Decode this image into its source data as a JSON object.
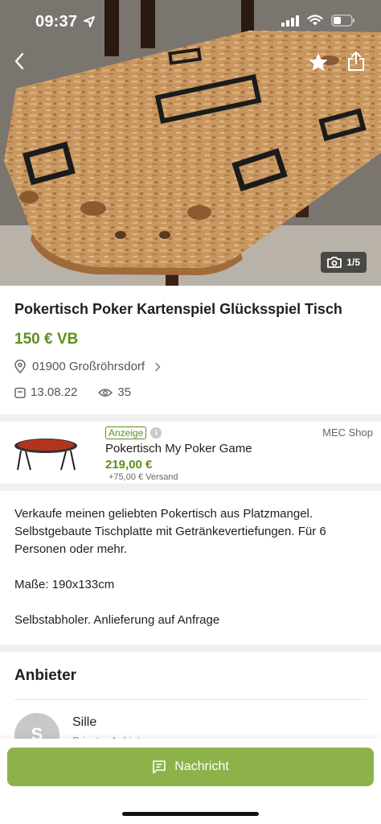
{
  "status_bar": {
    "time": "09:37",
    "icons": [
      "location-arrow-icon",
      "cellular-signal-icon",
      "wifi-icon",
      "battery-icon"
    ]
  },
  "hero": {
    "photo_counter": "1/5",
    "actions": [
      "back-icon",
      "star-icon",
      "share-icon"
    ]
  },
  "listing": {
    "title": "Pokertisch Poker Kartenspiel Glücksspiel Tisch",
    "price": "150 € VB",
    "location": "01900 Großröhrsdorf",
    "date": "13.08.22",
    "views": "35"
  },
  "ad": {
    "badge": "Anzeige",
    "shop": "MEC Shop",
    "title": "Pokertisch My Poker Game",
    "price": "219,00 €",
    "shipping": "+75,00 € Versand"
  },
  "description": {
    "line1": "Verkaufe meinen geliebten Pokertisch aus Platzmangel. Selbstgebaute Tischplatte mit Getränkevertiefungen. Für 6 Personen oder mehr.",
    "line2": "Maße: 190x133cm",
    "line3": "Selbstabholer. Anlieferung auf Anfrage"
  },
  "seller": {
    "heading": "Anbieter",
    "initial": "S",
    "name": "Sille",
    "type": "Privater Anbieter"
  },
  "bottom_bar": {
    "message_label": "Nachricht"
  },
  "colors": {
    "accent_green": "#5e8f1c",
    "button_green": "#8db24a"
  }
}
